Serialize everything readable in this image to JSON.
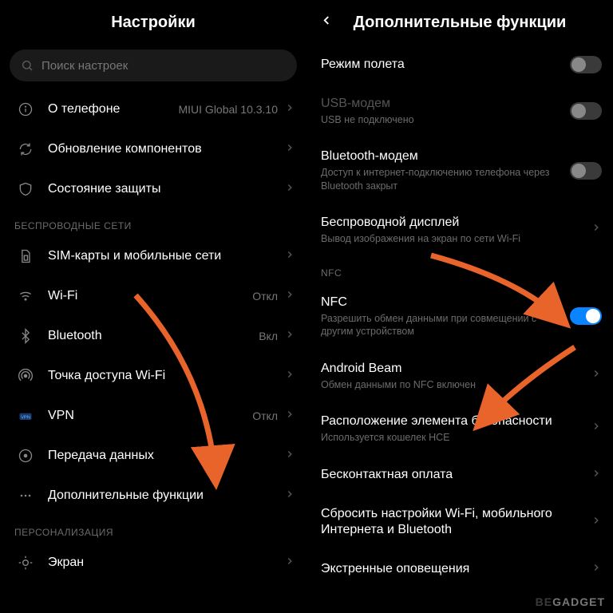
{
  "left": {
    "title": "Настройки",
    "search_placeholder": "Поиск настроек",
    "top_rows": [
      {
        "icon": "info",
        "label": "О телефоне",
        "value": "MIUI Global 10.3.10"
      },
      {
        "icon": "refresh",
        "label": "Обновление компонентов",
        "value": ""
      },
      {
        "icon": "shield",
        "label": "Состояние защиты",
        "value": ""
      }
    ],
    "section1": "БЕСПРОВОДНЫЕ СЕТИ",
    "wireless_rows": [
      {
        "icon": "sim",
        "label": "SIM-карты и мобильные сети",
        "value": ""
      },
      {
        "icon": "wifi",
        "label": "Wi-Fi",
        "value": "Откл"
      },
      {
        "icon": "bt",
        "label": "Bluetooth",
        "value": "Вкл"
      },
      {
        "icon": "hotspot",
        "label": "Точка доступа Wi-Fi",
        "value": ""
      },
      {
        "icon": "vpn",
        "label": "VPN",
        "value": "Откл"
      },
      {
        "icon": "data",
        "label": "Передача данных",
        "value": ""
      },
      {
        "icon": "more",
        "label": "Дополнительные функции",
        "value": ""
      }
    ],
    "section2": "ПЕРСОНАЛИЗАЦИЯ",
    "pers_rows": [
      {
        "icon": "display",
        "label": "Экран",
        "value": ""
      }
    ]
  },
  "right": {
    "title": "Дополнительные функции",
    "rows_top": [
      {
        "label": "Режим полета",
        "sub": "",
        "toggle": "off",
        "dim": false
      },
      {
        "label": "USB-модем",
        "sub": "USB не подключено",
        "toggle": "off",
        "dim": true
      },
      {
        "label": "Bluetooth-модем",
        "sub": "Доступ к интернет-подключению телефона через Bluetooth закрыт",
        "toggle": "off",
        "dim": false
      },
      {
        "label": "Беспроводной дисплей",
        "sub": "Вывод изображения на экран по сети Wi-Fi",
        "chev": true
      }
    ],
    "section_nfc": "NFC",
    "nfc_row": {
      "label": "NFC",
      "sub": "Разрешить обмен данными при совмещении с другим устройством",
      "toggle": "on"
    },
    "rows_bottom": [
      {
        "label": "Android Beam",
        "sub": "Обмен данными по NFC включен",
        "chev": true
      },
      {
        "label": "Расположение элемента безопасности",
        "sub": "Используется кошелек HCE",
        "chev": true
      },
      {
        "label": "Бесконтактная оплата",
        "sub": "",
        "chev": true
      },
      {
        "label": "Сбросить настройки Wi-Fi, мобильного Интернета и Bluetooth",
        "sub": "",
        "chev": true
      },
      {
        "label": "Экстренные оповещения",
        "sub": "",
        "chev": true
      }
    ]
  },
  "watermark": {
    "a": "BE",
    "b": "GADGET"
  }
}
